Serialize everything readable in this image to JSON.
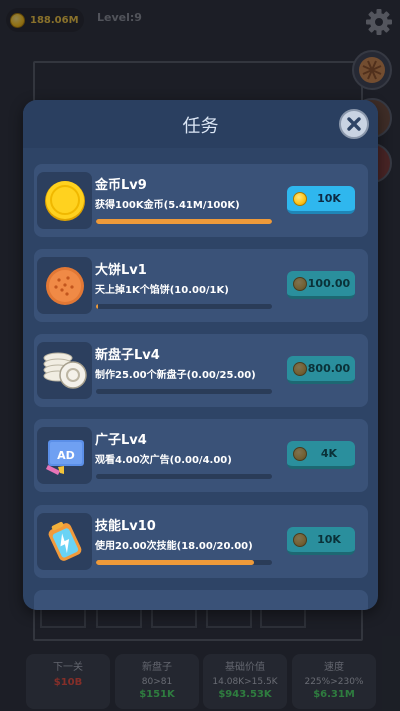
{
  "status_bar": {
    "money": "188.06M",
    "level": "Level:9"
  },
  "bottom_bar": [
    {
      "title": "下一关",
      "sub": "",
      "price": "$10B",
      "price_color": "#e74c3c"
    },
    {
      "title": "新盘子",
      "sub": "80>81",
      "price": "$151K",
      "price_color": "#4cd964"
    },
    {
      "title": "基础价值",
      "sub": "14.08K>15.5K",
      "price": "$943.53K",
      "price_color": "#4cd964"
    },
    {
      "title": "速度",
      "sub": "225%>230%",
      "price": "$6.31M",
      "price_color": "#4cd964"
    }
  ],
  "modal": {
    "title": "任务",
    "tasks": [
      {
        "name": "金币Lv9",
        "desc": "获得100K金币(5.41M/100K)",
        "progress": 1.0,
        "reward": "10K",
        "state": "active",
        "icon": "gold-coin-icon"
      },
      {
        "name": "大饼Lv1",
        "desc": "天上掉1K个馅饼(10.00/1K)",
        "progress": 0.01,
        "reward": "100.00",
        "state": "locked",
        "icon": "pie-icon"
      },
      {
        "name": "新盘子Lv4",
        "desc": "制作25.00个新盘子(0.00/25.00)",
        "progress": 0.0,
        "reward": "800.00",
        "state": "locked",
        "icon": "plates-icon"
      },
      {
        "name": "广子Lv4",
        "desc": "观看4.00次广告(0.00/4.00)",
        "progress": 0.0,
        "reward": "4K",
        "state": "locked",
        "icon": "ad-icon"
      },
      {
        "name": "技能Lv10",
        "desc": "使用20.00次技能(18.00/20.00)",
        "progress": 0.9,
        "reward": "10K",
        "state": "locked",
        "icon": "battery-icon"
      }
    ]
  },
  "colors": {
    "accent_orange": "#ee9a3a",
    "button_active": "#2fb7ee",
    "button_locked": "#2a8f9d",
    "modal_bg": "#2e4466"
  }
}
